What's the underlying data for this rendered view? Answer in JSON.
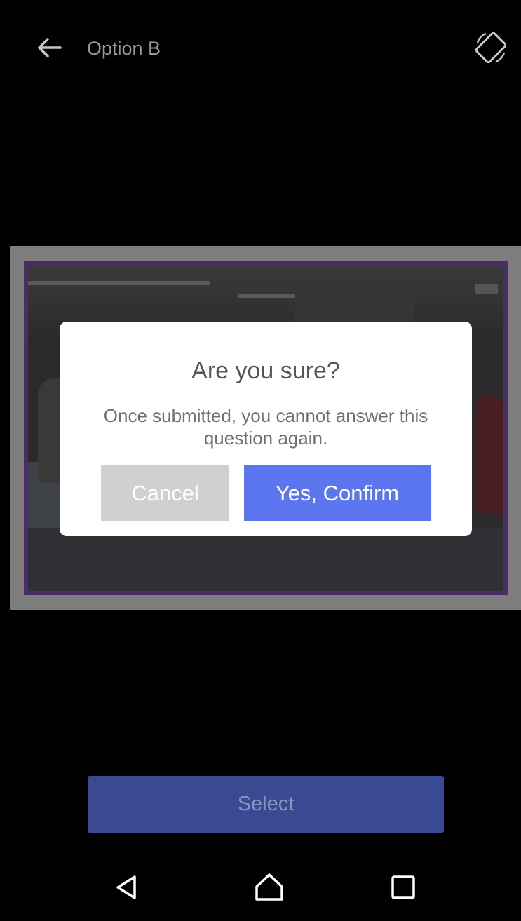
{
  "header": {
    "title": "Option B",
    "back_icon": "arrow-left-icon",
    "rotate_icon": "screen-rotation-icon"
  },
  "dialog": {
    "title": "Are you sure?",
    "message": "Once submitted, you cannot answer this question again.",
    "cancel_label": "Cancel",
    "confirm_label": "Yes, Confirm"
  },
  "footer": {
    "select_label": "Select"
  },
  "navigation": {
    "back_icon": "triangle-back-icon",
    "home_icon": "home-icon",
    "recent_icon": "square-recent-apps-icon"
  },
  "colors": {
    "confirm_button": "#5b76ee",
    "cancel_button": "#d0d0d0",
    "select_button": "#3a4a92",
    "photo_border": "#4a2c66"
  }
}
